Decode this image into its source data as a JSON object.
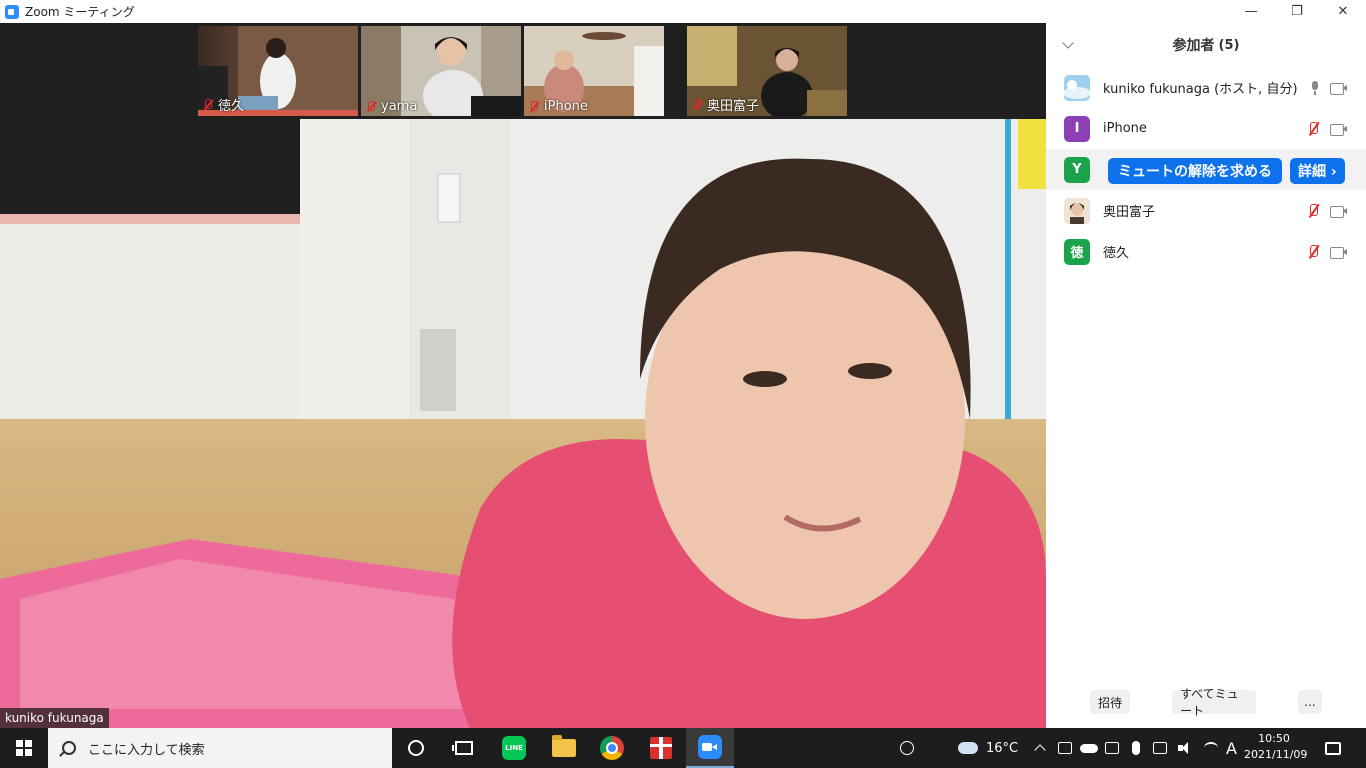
{
  "window": {
    "title": "Zoom ミーティング",
    "minimize": "—",
    "restore": "❐",
    "close": "✕"
  },
  "thumbnails": [
    {
      "name": "徳久",
      "muted": true
    },
    {
      "name": "yama",
      "muted": true
    },
    {
      "name": "iPhone",
      "muted": true
    },
    {
      "name": "奥田富子",
      "muted": true
    }
  ],
  "main_video": {
    "speaker_name": "kuniko fukunaga"
  },
  "participants_panel": {
    "title": "参加者",
    "count": "(5)",
    "participants": [
      {
        "name": "kuniko fukunaga (ホスト, 自分)",
        "avatar_letter": "",
        "avatar_color": "#6fb3e0",
        "mic": "on"
      },
      {
        "name": "iPhone",
        "avatar_letter": "I",
        "avatar_color": "#8d3fb5",
        "mic": "muted"
      },
      {
        "name": "",
        "avatar_letter": "Y",
        "avatar_color": "#1aa34a",
        "mic": "",
        "unmute_request_label": "ミュートの解除を求める",
        "details_label": "詳細 ›"
      },
      {
        "name": "奥田富子",
        "avatar_letter": "",
        "avatar_color": "#d8b89c",
        "mic": "muted"
      },
      {
        "name": "徳久",
        "avatar_letter": "徳",
        "avatar_color": "#1aa34a",
        "mic": "muted"
      }
    ],
    "footer": {
      "invite": "招待",
      "mute_all": "すべてミュート",
      "more": "..."
    }
  },
  "taskbar": {
    "search_placeholder": "ここに入力して検索",
    "weather": "16°C",
    "ime": "A",
    "time": "10:50",
    "date": "2021/11/09"
  }
}
